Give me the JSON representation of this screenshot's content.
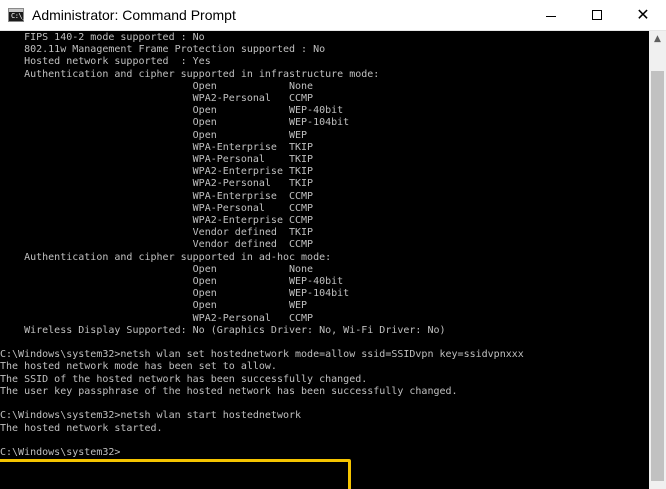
{
  "window": {
    "title": "Administrator: Command Prompt",
    "icon_name": "command-prompt-icon",
    "icon_glyph": "C:\\_",
    "controls": {
      "minimize_icon": "minimize-icon",
      "maximize_icon": "maximize-icon",
      "close_icon": "close-icon",
      "close_glyph": "✕"
    }
  },
  "console": {
    "lines": [
      "    FIPS 140-2 mode supported : No",
      "    802.11w Management Frame Protection supported : No",
      "    Hosted network supported  : Yes",
      "    Authentication and cipher supported in infrastructure mode:",
      "                                Open            None",
      "                                WPA2-Personal   CCMP",
      "                                Open            WEP-40bit",
      "                                Open            WEP-104bit",
      "                                Open            WEP",
      "                                WPA-Enterprise  TKIP",
      "                                WPA-Personal    TKIP",
      "                                WPA2-Enterprise TKIP",
      "                                WPA2-Personal   TKIP",
      "                                WPA-Enterprise  CCMP",
      "                                WPA-Personal    CCMP",
      "                                WPA2-Enterprise CCMP",
      "                                Vendor defined  TKIP",
      "                                Vendor defined  CCMP",
      "    Authentication and cipher supported in ad-hoc mode:",
      "                                Open            None",
      "                                Open            WEP-40bit",
      "                                Open            WEP-104bit",
      "                                Open            WEP",
      "                                WPA2-Personal   CCMP",
      "    Wireless Display Supported: No (Graphics Driver: No, Wi-Fi Driver: No)",
      "",
      "C:\\Windows\\system32>netsh wlan set hostednetwork mode=allow ssid=SSIDvpn key=ssidvpnxxx",
      "The hosted network mode has been set to allow.",
      "The SSID of the hosted network has been successfully changed.",
      "The user key passphrase of the hosted network has been successfully changed.",
      "",
      "C:\\Windows\\system32>netsh wlan start hostednetwork",
      "The hosted network started.",
      "",
      "C:\\Windows\\system32>"
    ],
    "text_color": "#c0c0c0",
    "background": "#000000"
  },
  "highlight": {
    "color": "#f5c400"
  },
  "scrollbar": {
    "up_arrow": "▲",
    "up_arrow_icon": "scroll-up-arrow-icon"
  }
}
